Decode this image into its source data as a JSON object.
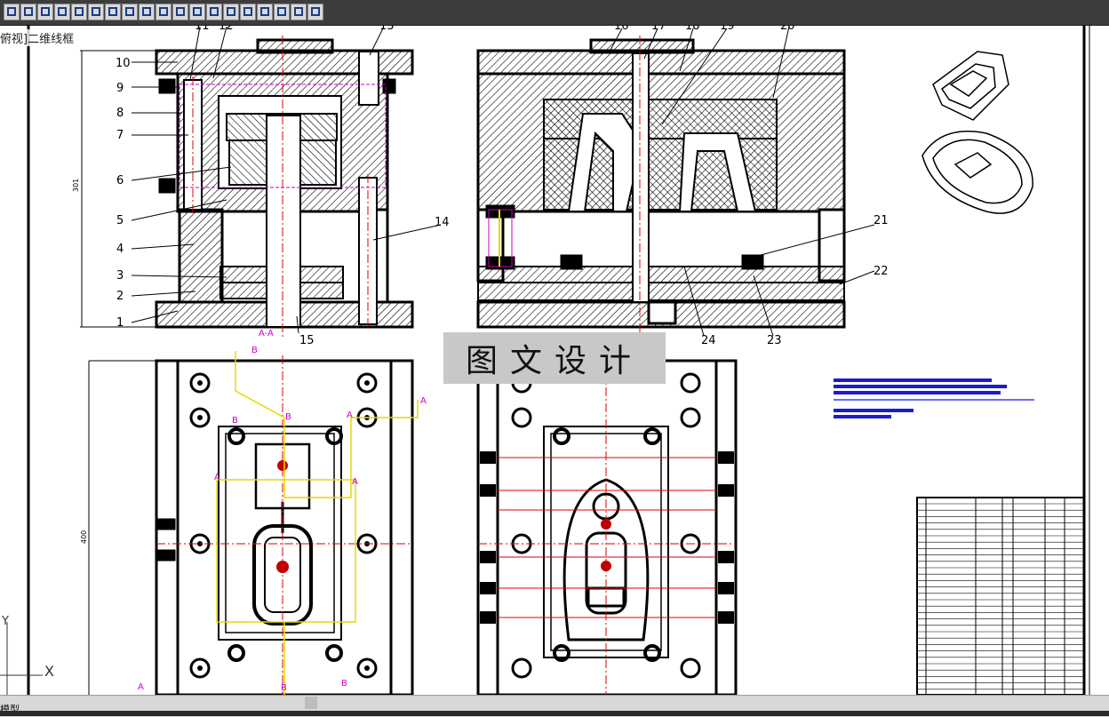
{
  "app": {
    "view_label": "俯视]二维线框",
    "layout_tab": "模型",
    "watermark": "图文设计"
  },
  "toolbar": {
    "icons": [
      "line-icon",
      "polyline-icon",
      "rect-icon",
      "hatch-icon",
      "circle-icon",
      "text-icon",
      "dim-icon",
      "block-icon",
      "insert-icon",
      "layer-icon",
      "array-icon",
      "mirror-icon",
      "offset-icon",
      "trim-icon",
      "extend-icon",
      "snap-icon",
      "center-icon",
      "filter-icon",
      "measure-icon"
    ]
  },
  "ucs": {
    "x_label": "X",
    "y_label": "Y"
  },
  "drawing": {
    "section_label": "A-A",
    "dims": {
      "height_left": "301",
      "height_bottom": "400"
    },
    "callouts_left": [
      "1",
      "2",
      "3",
      "4",
      "5",
      "6",
      "7",
      "8",
      "9",
      "10",
      "11",
      "12",
      "13",
      "14",
      "15"
    ],
    "callouts_right": [
      "16",
      "17",
      "18",
      "19",
      "20",
      "21",
      "22",
      "23",
      "24"
    ],
    "section_marks": [
      "A",
      "A",
      "A",
      "A",
      "B",
      "B",
      "B",
      "B",
      "B",
      "B"
    ]
  },
  "colors": {
    "line": "#000000",
    "hatch": "#000000",
    "center": "#e00000",
    "section": "#cc00cc",
    "yellow": "#e8d800",
    "blue_bar": "#1c1ccc"
  }
}
